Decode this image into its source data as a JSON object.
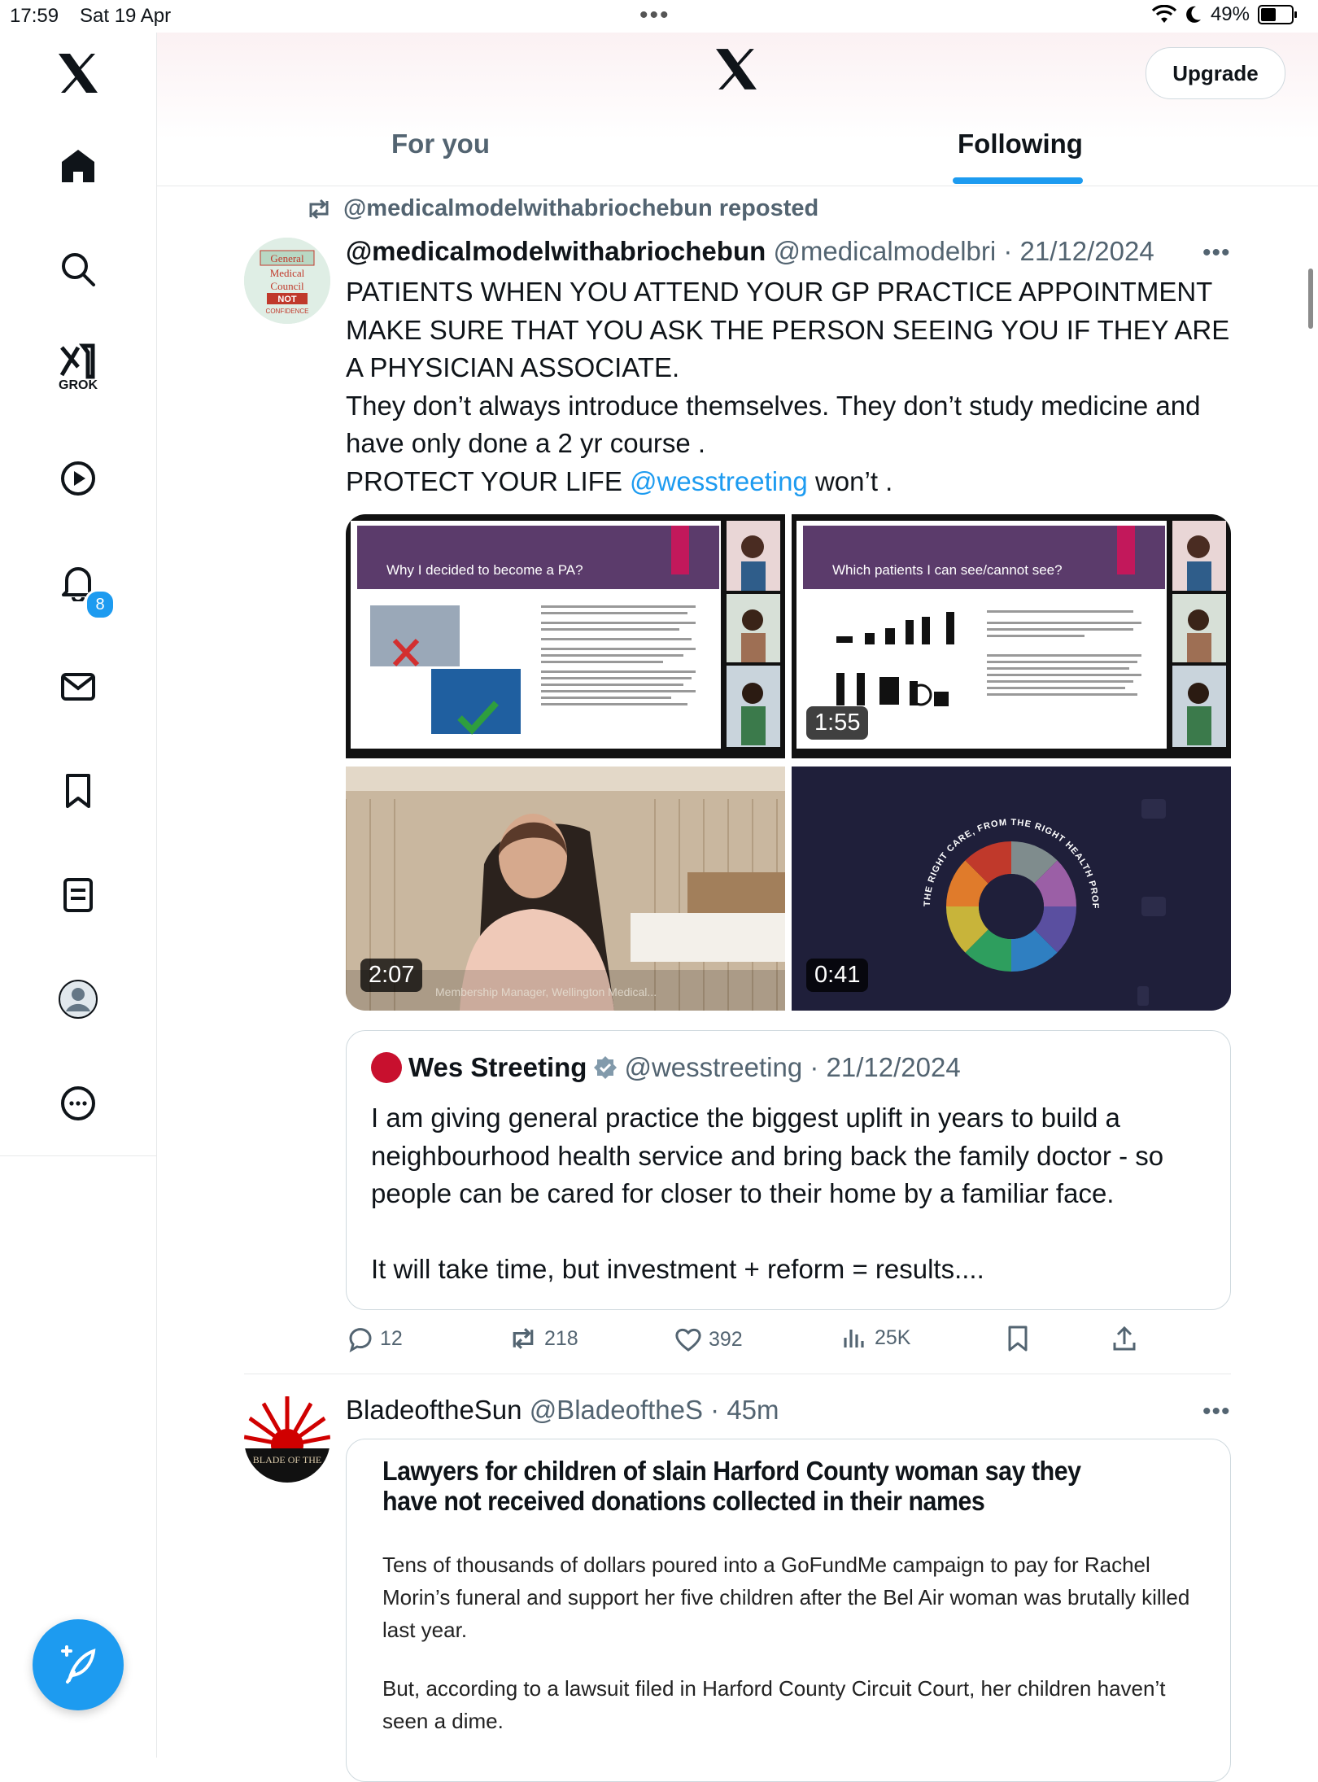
{
  "status": {
    "time": "17:59",
    "date": "Sat 19 Apr",
    "battery": "49%",
    "battery_level": 0.49
  },
  "sidebar": {
    "items": [
      {
        "name": "home",
        "icon": "home-icon"
      },
      {
        "name": "explore",
        "icon": "search-icon"
      },
      {
        "name": "grok",
        "icon": "grok-icon",
        "label": "GROK"
      },
      {
        "name": "video",
        "icon": "play-icon"
      },
      {
        "name": "notifications",
        "icon": "bell-icon",
        "badge": "8"
      },
      {
        "name": "messages",
        "icon": "mail-icon"
      },
      {
        "name": "bookmarks",
        "icon": "bookmark-icon"
      },
      {
        "name": "lists",
        "icon": "list-icon"
      },
      {
        "name": "profile",
        "icon": "avatar-icon"
      },
      {
        "name": "more",
        "icon": "more-circle-icon"
      }
    ],
    "accent": "#1d9bf0"
  },
  "header": {
    "upgrade": "Upgrade",
    "tabs": [
      {
        "label": "For you"
      },
      {
        "label": "Following",
        "active": true
      }
    ]
  },
  "tweet1": {
    "repost_label": "@medicalmodelwithabriochebun reposted",
    "name": "@medicalmodelwithabriochebun",
    "meta": "@medicalmodelbri · 21/12/2024",
    "avatar_text": [
      "General",
      "Medical",
      "Council",
      "NOT",
      "CONFIDENCE"
    ],
    "text_lines": [
      "PATIENTS WHEN YOU ATTEND YOUR GP PRACTICE APPOINTMENT MAKE SURE THAT YOU ASK THE PERSON SEEING YOU IF THEY ARE A PHYSICIAN ASSOCIATE.",
      "They don’t always introduce themselves. They don’t study medicine and have only done a 2 yr course .",
      "PROTECT YOUR LIFE"
    ],
    "mention": "@wesstreeting",
    "text_end": " won’t .",
    "media": [
      {
        "slide_title": "Why I decided to become a PA?",
        "duration": ""
      },
      {
        "slide_title": "Which patients I can see/cannot see?",
        "duration": "1:55"
      },
      {
        "caption": "Membership Manager, Wellington Medical...",
        "duration": "2:07"
      },
      {
        "ring_text": "THE RIGHT CARE, FROM THE RIGHT HEALTH PROFESSIONAL.",
        "duration": "0:41"
      }
    ],
    "quote": {
      "name": "Wes Streeting",
      "handle_meta": "@wesstreeting · 21/12/2024",
      "text1": "I am giving general practice the biggest uplift in years to build a neighbourhood health service and bring back the family doctor - so people can be cared for closer to their home by a familiar face.",
      "text2": "It will take time, but investment + reform = results...."
    },
    "actions": {
      "replies": "12",
      "reposts": "218",
      "likes": "392",
      "views": "25K"
    }
  },
  "tweet2": {
    "name": "BladeoftheSun",
    "meta": "@BladeoftheS · 45m",
    "avatar_text": "BLADE OF THE",
    "article": {
      "headline": "Lawyers for children of slain Harford County woman say they have not received donations collected in their names",
      "para1": "Tens of thousands of dollars poured into a GoFundMe campaign to pay for Rachel Morin’s funeral and support her five children after the Bel Air woman was brutally killed last year.",
      "para2": "But, according to a lawsuit filed in Harford County Circuit Court, her children haven’t seen a dime."
    }
  }
}
